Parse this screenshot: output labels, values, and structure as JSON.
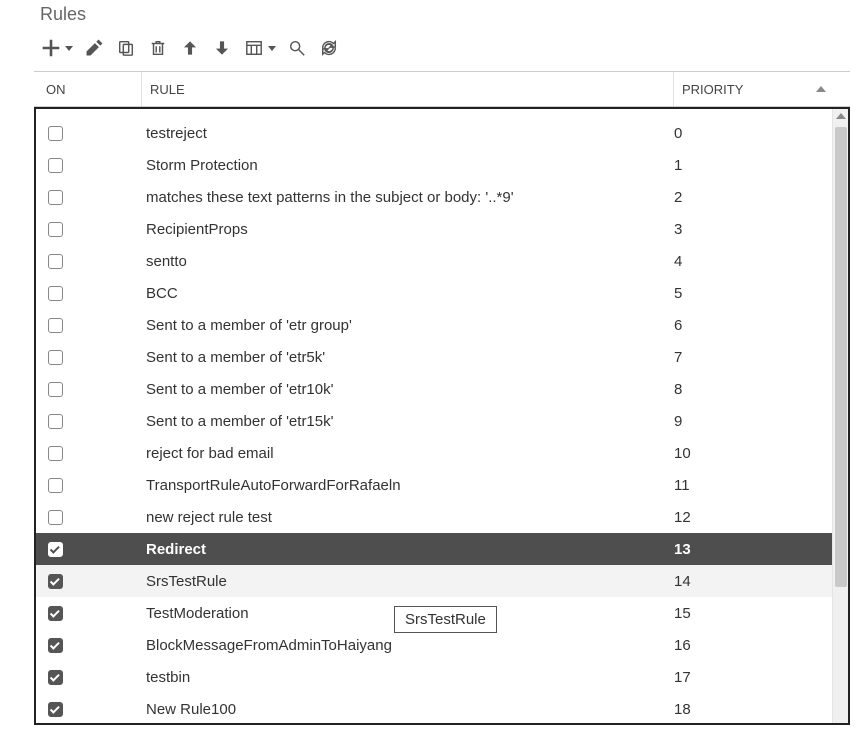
{
  "title": "Rules",
  "toolbar": {
    "add": "Add",
    "edit": "Edit",
    "copy": "Copy",
    "delete": "Delete",
    "move_up": "Move up",
    "move_down": "Move down",
    "columns": "Columns",
    "search": "Search",
    "refresh": "Refresh"
  },
  "columns": {
    "on": "ON",
    "rule": "RULE",
    "priority": "PRIORITY"
  },
  "tooltip": "SrsTestRule",
  "rows": [
    {
      "on": false,
      "rule": "testreject",
      "priority": "0",
      "selected": false
    },
    {
      "on": false,
      "rule": "Storm Protection",
      "priority": "1",
      "selected": false
    },
    {
      "on": false,
      "rule": "matches these text patterns in the subject or body: '..*9'",
      "priority": "2",
      "selected": false
    },
    {
      "on": false,
      "rule": "RecipientProps",
      "priority": "3",
      "selected": false
    },
    {
      "on": false,
      "rule": "sentto",
      "priority": "4",
      "selected": false
    },
    {
      "on": false,
      "rule": "BCC",
      "priority": "5",
      "selected": false
    },
    {
      "on": false,
      "rule": "Sent to a member of 'etr group'",
      "priority": "6",
      "selected": false
    },
    {
      "on": false,
      "rule": "Sent to a member of 'etr5k'",
      "priority": "7",
      "selected": false
    },
    {
      "on": false,
      "rule": "Sent to a member of 'etr10k'",
      "priority": "8",
      "selected": false
    },
    {
      "on": false,
      "rule": "Sent to a member of 'etr15k'",
      "priority": "9",
      "selected": false
    },
    {
      "on": false,
      "rule": "reject for bad email",
      "priority": "10",
      "selected": false
    },
    {
      "on": false,
      "rule": "TransportRuleAutoForwardForRafaeln",
      "priority": "11",
      "selected": false
    },
    {
      "on": false,
      "rule": "new reject rule test",
      "priority": "12",
      "selected": false
    },
    {
      "on": true,
      "rule": "Redirect",
      "priority": "13",
      "selected": true
    },
    {
      "on": true,
      "rule": "SrsTestRule",
      "priority": "14",
      "selected": false,
      "alt": true
    },
    {
      "on": true,
      "rule": "TestModeration",
      "priority": "15",
      "selected": false
    },
    {
      "on": true,
      "rule": "BlockMessageFromAdminToHaiyang",
      "priority": "16",
      "selected": false
    },
    {
      "on": true,
      "rule": "testbin",
      "priority": "17",
      "selected": false
    },
    {
      "on": true,
      "rule": "New Rule100",
      "priority": "18",
      "selected": false
    }
  ]
}
